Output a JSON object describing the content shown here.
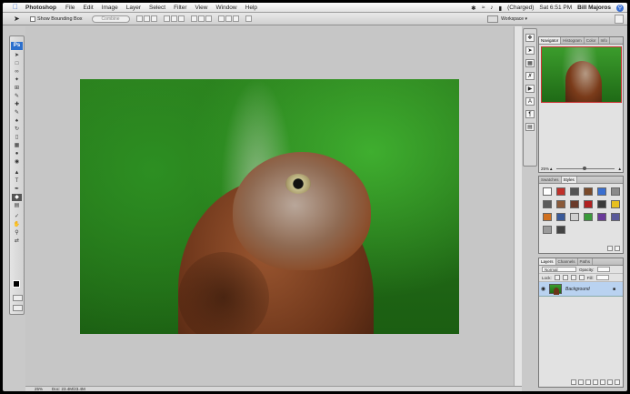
{
  "menubar": {
    "app": "Photoshop",
    "items": [
      "File",
      "Edit",
      "Image",
      "Layer",
      "Select",
      "Filter",
      "View",
      "Window",
      "Help"
    ],
    "battery": "(Charged)",
    "clock": "Sat 6:51 PM",
    "user": "Bill Majoros"
  },
  "options": {
    "show_bounding_box": "Show Bounding Box",
    "combine": "Combine",
    "workspace": "Workspace ▾"
  },
  "navigator": {
    "tabs": [
      "Navigator",
      "Histogram",
      "Color",
      "Info"
    ],
    "zoom": "25%"
  },
  "swatches": {
    "tabs": [
      "Swatches",
      "Styles"
    ],
    "styles": [
      "#ffffff",
      "#c0302a",
      "#555555",
      "#7a4a2a",
      "#3a6fd0",
      "#8a8a8a",
      "#5a5a5a",
      "#8a5a3a",
      "#6a3a2a",
      "#b02020",
      "#3a3a3a",
      "#e8c020",
      "#d07020",
      "#3a5a9a",
      "#cfcfcf",
      "#3a9a3a",
      "#6a3a9a",
      "#5a5a9a",
      "#9a9a9a",
      "#444444"
    ]
  },
  "layers": {
    "tabs": [
      "Layers",
      "Channels",
      "Paths"
    ],
    "blend_mode": "Normal",
    "opacity_label": "Opacity:",
    "lock_label": "Lock:",
    "fill_label": "Fill:",
    "layer_name": "Background"
  },
  "status": {
    "zoom": "25%",
    "doc": "Doc: 23.4M/23.4M"
  },
  "colors": {
    "ps_blue": "#2c6fcc",
    "selection_blue": "#b9d2f0"
  }
}
